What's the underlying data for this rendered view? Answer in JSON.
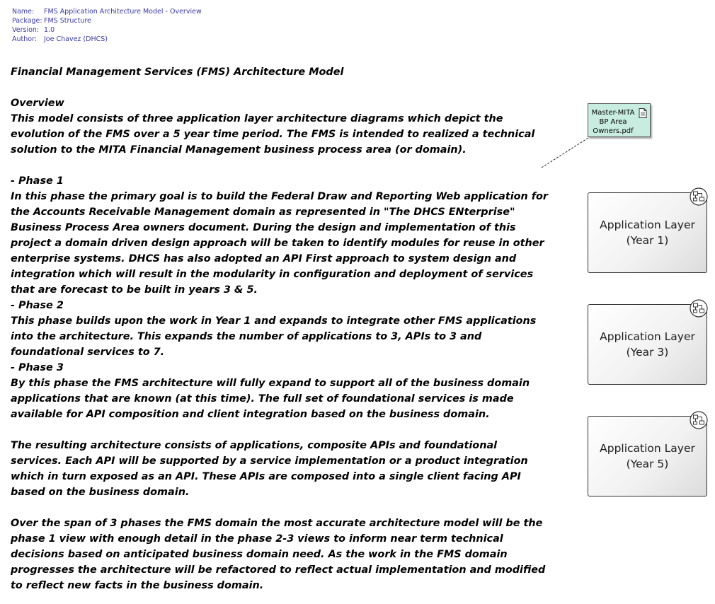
{
  "metadata": [
    {
      "key": "Name:",
      "value": "FMS Application Architecture Model - Overview"
    },
    {
      "key": "Package:",
      "value": "FMS Structure"
    },
    {
      "key": "Version:",
      "value": "1.0"
    },
    {
      "key": "Author:",
      "value": "Joe Chavez (DHCS)"
    }
  ],
  "notes": {
    "title": "Financial Management Services (FMS) Architecture Model",
    "overview_heading": "Overview",
    "overview_text": "This model consists of three application layer architecture diagrams which depict the evolution of the FMS over a 5 year time period. The FMS is intended to realized a technical solution to the MITA Financial Management business process area (or domain).",
    "phase1_heading": "- Phase 1",
    "phase1_text": "In this phase the primary goal is to build the Federal Draw and Reporting Web application for the Accounts Receivable Management domain as represented in \"The DHCS ENterprise\" Business Process Area owners document. During the design and implementation of this project a domain driven design approach will be taken to identify modules for reuse in other enterprise systems. DHCS has also adopted an API First approach to system design and integration which will result in the modularity in configuration and deployment of services that are forecast to be built in years 3 & 5.",
    "phase2_heading": "- Phase 2",
    "phase2_text": "This phase builds upon the work in Year 1 and expands to integrate other FMS applications into the architecture.  This expands the number of applications to 3, APIs to 3 and foundational services to 7.",
    "phase3_heading": "- Phase 3",
    "phase3_text": "By this phase the FMS architecture will fully expand to support all of the business domain applications that are known (at this time). The full set of foundational services is made available for API composition and client integration based on the business domain.",
    "result_text": "The resulting architecture consists of applications, composite APIs and foundational services. Each API will be supported by a service implementation or a product integration which in turn exposed as an API. These APIs are composed into a single client facing API based on the business domain.",
    "span_text": "Over the span of 3 phases the FMS domain the most accurate architecture model will be the phase 1 view with enough detail in the phase 2-3 views to inform near term technical decisions based on anticipated business domain need. As the work in the FMS domain progresses the architecture will be refactored to reflect actual implementation and modified to reflect new facts in the business domain."
  },
  "artifact": {
    "label": "Master-MITA BP Area Owners.pdf",
    "icon": "document-icon",
    "color": "#c9ece1"
  },
  "diagrams": [
    {
      "label": "Application Layer\n(Year 1)",
      "icon": "diagram-link-icon"
    },
    {
      "label": "Application Layer\n(Year 3)",
      "icon": "diagram-link-icon"
    },
    {
      "label": "Application Layer\n(Year 5)",
      "icon": "diagram-link-icon"
    }
  ]
}
